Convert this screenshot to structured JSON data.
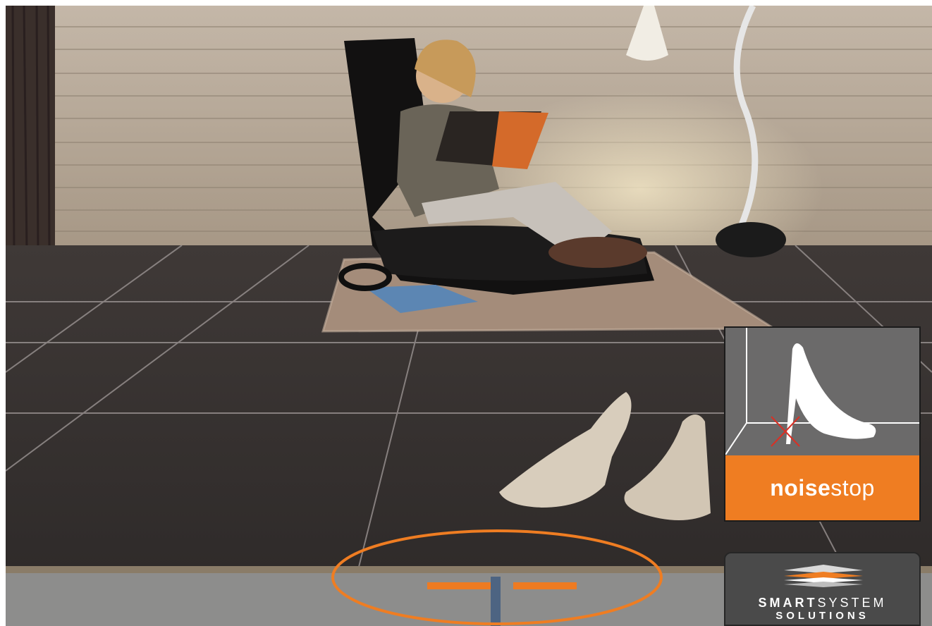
{
  "scene": {
    "description_icon": "photo-scene",
    "colors": {
      "accent": "#ef7d22",
      "floor": "#3c3837",
      "wall": "#b8aa9a"
    }
  },
  "noise_badge": {
    "label_bold": "noise",
    "label_light": "stop",
    "icon": "high-heel-icon"
  },
  "smart_badge": {
    "line1_bold": "SMART",
    "line1_light": "SYSTEM",
    "line2": "SOLUTIONS",
    "icon": "layers-logo-icon"
  }
}
